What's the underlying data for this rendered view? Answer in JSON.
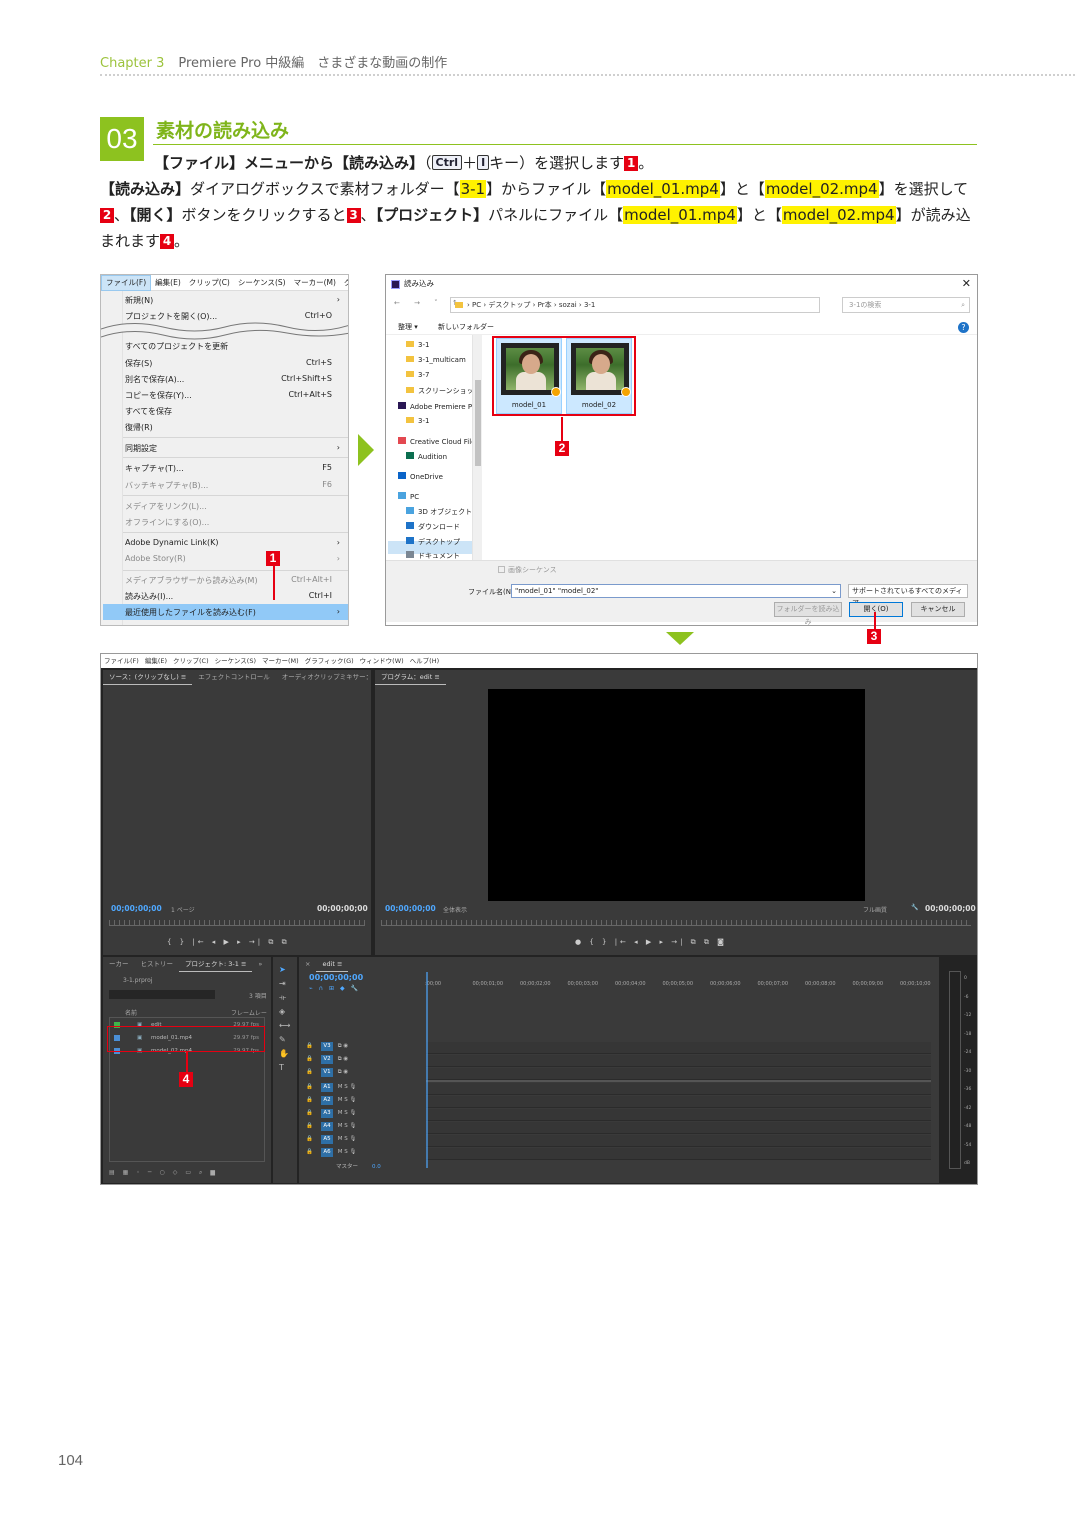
{
  "header": {
    "chapter_label": "Chapter 3",
    "chapter_title": "Premiere Pro 中級編　さまざまな動画の制作"
  },
  "section": {
    "number": "03",
    "title": "素材の読み込み"
  },
  "instruction": {
    "line1_a": "【ファイル】メニューから【読み込み】",
    "line1_b": "（",
    "key_ctrl": "Ctrl",
    "plus": "＋",
    "key_i": "I",
    "line1_c": "キー）を選択します",
    "step1": "1",
    "line1_d": "。",
    "line2_a": "【読み込み】",
    "line2_b": "ダイアログボックスで素材フォルダー【",
    "folder": "3-1",
    "line2_c": "】からファイル【",
    "file1": "model_01.mp4",
    "line2_d": "】と【",
    "file2": "model_02.mp4",
    "line2_e": "】を選択して",
    "step2": "2",
    "line2_f": "、",
    "open_btn": "【開く】",
    "line2_g": "ボタンをクリックすると",
    "step3": "3",
    "line2_h": "、",
    "project_panel": "【プロジェクト】",
    "line2_i": "パネルにファイル【",
    "file1b": "model_01.mp4",
    "line2_j": "】と【",
    "file2b": "model_02.mp4",
    "line2_k": "】が読み込まれます",
    "step4": "4",
    "line2_l": "。"
  },
  "file_menu": {
    "menubar": [
      "ファイル(F)",
      "編集(E)",
      "クリップ(C)",
      "シーケンス(S)",
      "マーカー(M)",
      "グラ"
    ],
    "items": [
      {
        "label": "新規(N)",
        "shortcut": "",
        "arrow": "›"
      },
      {
        "label": "プロジェクトを開く(O)...",
        "shortcut": "Ctrl+O",
        "arrow": ""
      },
      {
        "label": "すべてのプロジェクトを更新",
        "shortcut": "",
        "arrow": ""
      },
      {
        "label": "保存(S)",
        "shortcut": "Ctrl+S",
        "arrow": ""
      },
      {
        "label": "別名で保存(A)...",
        "shortcut": "Ctrl+Shift+S",
        "arrow": ""
      },
      {
        "label": "コピーを保存(Y)...",
        "shortcut": "Ctrl+Alt+S",
        "arrow": ""
      },
      {
        "label": "すべてを保存",
        "shortcut": "",
        "arrow": ""
      },
      {
        "label": "復帰(R)",
        "shortcut": "",
        "arrow": ""
      },
      {
        "label": "同期設定",
        "shortcut": "",
        "arrow": "›"
      },
      {
        "label": "キャプチャ(T)...",
        "shortcut": "F5",
        "arrow": ""
      },
      {
        "label": "バッチキャプチャ(B)...",
        "shortcut": "F6",
        "arrow": ""
      },
      {
        "label": "メディアをリンク(L)...",
        "shortcut": "",
        "arrow": ""
      },
      {
        "label": "オフラインにする(O)...",
        "shortcut": "",
        "arrow": ""
      },
      {
        "label": "Adobe Dynamic Link(K)",
        "shortcut": "",
        "arrow": "›"
      },
      {
        "label": "Adobe Story(R)",
        "shortcut": "",
        "arrow": "›"
      },
      {
        "label": "メディアブラウザーから読み込み(M)",
        "shortcut": "Ctrl+Alt+I",
        "arrow": ""
      },
      {
        "label": "読み込み(I)...",
        "shortcut": "Ctrl+I",
        "arrow": ""
      },
      {
        "label": "最近使用したファイルを読み込む(F)",
        "shortcut": "",
        "arrow": "›"
      }
    ]
  },
  "open_dialog": {
    "title": "読み込み",
    "close": "✕",
    "nav": "← → ˅ ↑",
    "path": "› PC › デスクトップ › Pr本 › sozai › 3-1",
    "search_placeholder": "3-1の検索",
    "toolbar_organize": "整理 ▾",
    "toolbar_new_folder": "新しいフォルダー",
    "help": "?",
    "tree": [
      "3-1",
      "3-1_multicam",
      "3-7",
      "スクリーンショット",
      "Adobe Premiere P",
      "3-1",
      "Creative Cloud File",
      "Audition",
      "OneDrive",
      "PC",
      "3D オブジェクト",
      "ダウンロード",
      "デスクトップ",
      "ドキュメント"
    ],
    "files": [
      "model_01",
      "model_02"
    ],
    "image_sequence": "画像シーケンス",
    "filename_label": "ファイル名(N):",
    "filename_value": "\"model_01\" \"model_02\"",
    "filetype": "サポートされているすべてのメディア",
    "btn_import_folder": "フォルダーを読み込み",
    "btn_open": "開く(O)",
    "btn_cancel": "キャンセル"
  },
  "premiere": {
    "menubar": [
      "ファイル(F)",
      "編集(E)",
      "クリップ(C)",
      "シーケンス(S)",
      "マーカー(M)",
      "グラフィック(G)",
      "ウィンドウ(W)",
      "ヘルプ(H)"
    ],
    "source_tabs": [
      "ソース：(クリップなし) ≡",
      "エフェクトコントロール",
      "オーディオクリップミキサー：",
      "»"
    ],
    "program_tab": "プログラム：edit ≡",
    "source_tc_left": "00;00;00;00",
    "source_page": "1 ページ",
    "source_tc_right": "00;00;00;00",
    "program_tc_left": "00;00;00;00",
    "program_fit": "全体表示",
    "program_full": "フル画質",
    "program_tc_right": "00;00;00;00",
    "transport_source": "{ } |← ◂ ▶ ▸ →| ⧉ ⧉",
    "transport_program": "● { } |← ◂ ▶ ▸ →| ⧉ ⧉ ◙",
    "project_tabs": [
      "ーカー",
      "ヒストリー",
      "プロジェクト: 3-1 ≡",
      "»"
    ],
    "project_file": "3-1.prproj",
    "project_count": "3 項目",
    "col_name": "名前",
    "col_fps": "フレームレー",
    "rows": [
      {
        "name": "edit",
        "fps": "29.97 fps",
        "color": "#3fb54a"
      },
      {
        "name": "model_01.mp4",
        "fps": "29.97 fps",
        "color": "#4a8fd6"
      },
      {
        "name": "model_02.mp4",
        "fps": "29.97 fps",
        "color": "#4a8fd6"
      }
    ],
    "timeline_tab": "edit ≡",
    "timeline_tc": "00;00;00;00",
    "timeline_ticks": [
      ":00;00",
      "00;00;01;00",
      "00;00;02;00",
      "00;00;03;00",
      "00;00;04;00",
      "00;00;05;00",
      "00;00;06;00",
      "00;00;07;00",
      "00;00;08;00",
      "00;00;09;00",
      "00;00;10;00"
    ],
    "video_tracks": [
      "V3",
      "V2",
      "V1"
    ],
    "audio_tracks": [
      "A1",
      "A2",
      "A3",
      "A4",
      "A5",
      "A6"
    ],
    "master": "マスター",
    "master_val": "0.0",
    "meter_ticks": [
      "0",
      "-6",
      "-12",
      "-18",
      "-24",
      "-30",
      "-36",
      "-42",
      "-48",
      "-54",
      "dB"
    ]
  },
  "page_number": "104"
}
